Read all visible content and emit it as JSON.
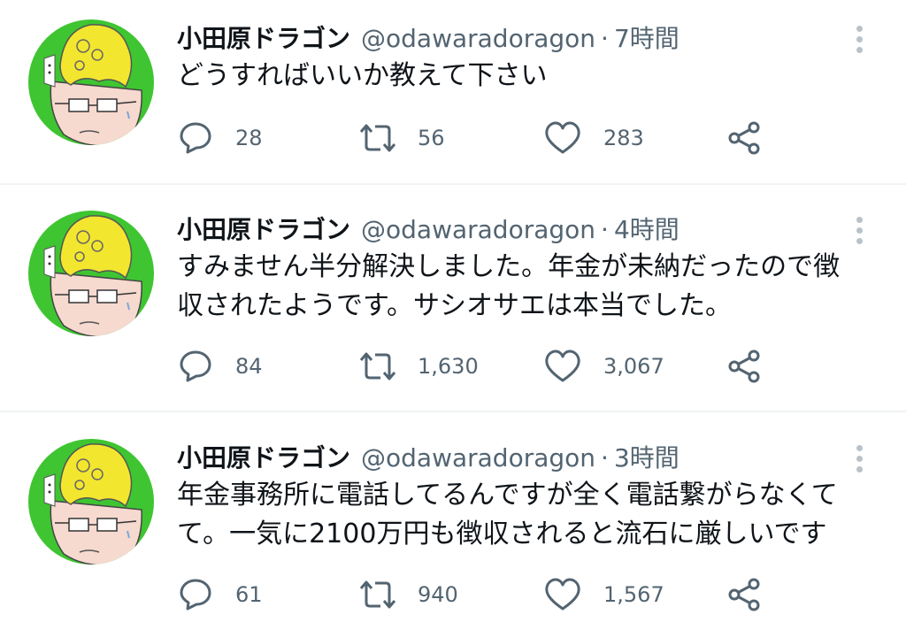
{
  "tweets": [
    {
      "display_name": "小田原ドラゴン",
      "handle": "@odawaradoragon",
      "separator": "·",
      "time": "7時間",
      "lines": [
        "どうすればいいか教えて下さい"
      ],
      "replies": "28",
      "retweets": "56",
      "likes": "283"
    },
    {
      "display_name": "小田原ドラゴン",
      "handle": "@odawaradoragon",
      "separator": "·",
      "time": "4時間",
      "lines": [
        "すみません半分解決しました。年金が未納だったので徴",
        "収されたようです。サシオサエは本当でした。"
      ],
      "replies": "84",
      "retweets": "1,630",
      "likes": "3,067"
    },
    {
      "display_name": "小田原ドラゴン",
      "handle": "@odawaradoragon",
      "separator": "·",
      "time": "3時間",
      "lines": [
        "年金事務所に電話してるんですが全く電話繋がらなくて",
        "て。一気に2100万円も徴収されると流石に厳しいです"
      ],
      "replies": "61",
      "retweets": "940",
      "likes": "1,567"
    }
  ],
  "icons": {
    "reply": "reply-icon",
    "retweet": "retweet-icon",
    "like": "heart-icon",
    "share": "share-icon",
    "more": "more-vertical-icon",
    "avatar": "avatar-cartoon-icon"
  },
  "colors": {
    "text": "#0f1419",
    "secondary": "#536471",
    "avatar_bg": "#3ec531",
    "hair": "#f3e62f",
    "divider": "#eff3f4"
  }
}
